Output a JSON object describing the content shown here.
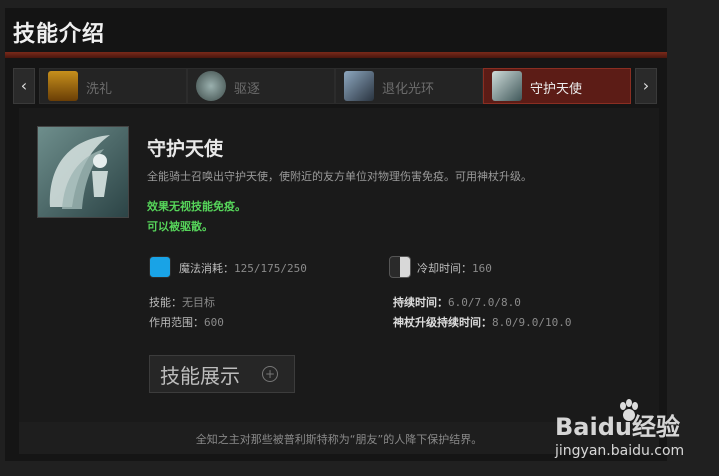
{
  "header": {
    "title": "技能介绍"
  },
  "tabs": [
    {
      "label": "洗礼",
      "icon": "baptism-icon",
      "active": false
    },
    {
      "label": "驱逐",
      "icon": "purge-icon",
      "active": false
    },
    {
      "label": "退化光环",
      "icon": "degen-aura-icon",
      "active": false
    },
    {
      "label": "守护天使",
      "icon": "guardian-angel-icon",
      "active": true
    }
  ],
  "nav": {
    "prev": "‹",
    "next": "›"
  },
  "skill": {
    "name": "守护天使",
    "description": "全能骑士召唤出守护天使，使附近的友方单位对物理伤害免疫。可用神杖升级。",
    "note1": "效果无视技能免疫。",
    "note2": "可以被驱散。",
    "mana": {
      "label": "魔法消耗：",
      "value": "125/175/250"
    },
    "cooldown": {
      "label": "冷却时间：",
      "value": "160"
    },
    "ability": {
      "label": "技能：",
      "value": "无目标"
    },
    "aoe": {
      "label": "作用范围：",
      "value": "600"
    },
    "duration": {
      "label": "持续时间：",
      "value": "6.0/7.0/8.0"
    },
    "scepter_duration": {
      "label": "神杖升级持续时间：",
      "value": "8.0/9.0/10.0"
    }
  },
  "demo_button": {
    "label": "技能展示"
  },
  "footer": {
    "lore": "全知之主对那些被普利斯特称为“朋友”的人降下保护结界。"
  },
  "watermark": {
    "brand": "Baidu经验",
    "url": "jingyan.baidu.com"
  },
  "colors": {
    "accent_red": "#7a2a1a",
    "active_tab": "#5c1c16",
    "mana_blue": "#19a3e6",
    "note_green": "#56d45a"
  }
}
